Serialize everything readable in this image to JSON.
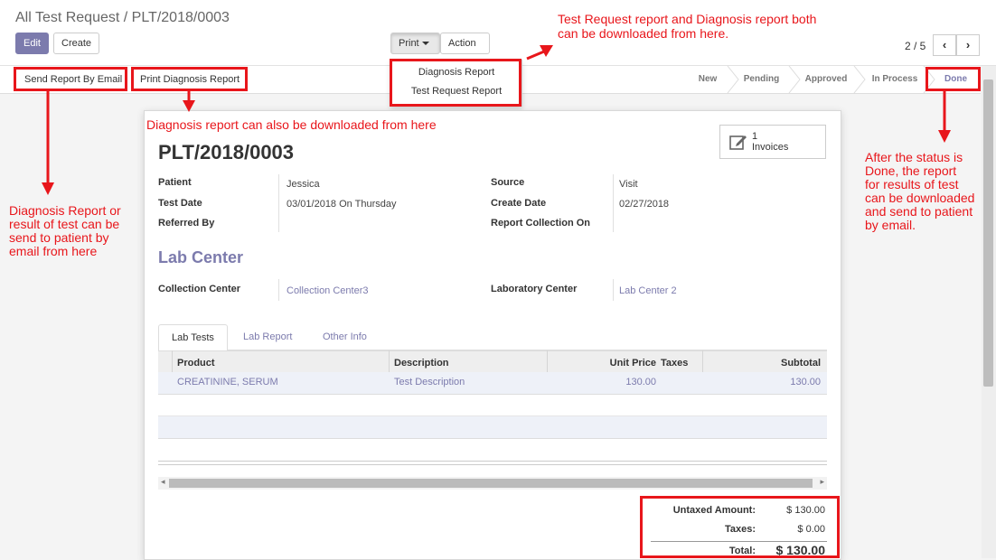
{
  "breadcrumb": {
    "parent": "All Test Request",
    "sep": " / ",
    "current": "PLT/2018/0003"
  },
  "toolbar": {
    "edit": "Edit",
    "create": "Create",
    "print": "Print",
    "action": "Action"
  },
  "pager": {
    "value": "2 / 5",
    "prev": "‹",
    "next": "›"
  },
  "print_menu": {
    "items": [
      "Diagnosis Report",
      "Test Request Report"
    ]
  },
  "statusbar": {
    "send_email": "Send Report By Email",
    "print_diagnosis": "Print Diagnosis Report",
    "stages": [
      "New",
      "Pending",
      "Approved",
      "In Process",
      "Done"
    ],
    "current_stage": "Done"
  },
  "record": {
    "name": "PLT/2018/0003",
    "invoices_count": "1",
    "invoices_label": "Invoices",
    "fields_left": [
      {
        "label": "Patient",
        "value": "Jessica"
      },
      {
        "label": "Test Date",
        "value": "03/01/2018 On Thursday"
      },
      {
        "label": "Referred By",
        "value": ""
      }
    ],
    "fields_right": [
      {
        "label": "Source",
        "value": "Visit"
      },
      {
        "label": "Create Date",
        "value": "02/27/2018"
      },
      {
        "label": "Report Collection On",
        "value": ""
      }
    ],
    "section_title": "Lab Center",
    "collection_center_label": "Collection Center",
    "collection_center_value": "Collection Center3",
    "laboratory_center_label": "Laboratory Center",
    "laboratory_center_value": "Lab Center 2"
  },
  "tabs": [
    "Lab Tests",
    "Lab Report",
    "Other Info"
  ],
  "table": {
    "headers": [
      "Product",
      "Description",
      "Unit Price",
      "Taxes",
      "Subtotal"
    ],
    "rows": [
      {
        "product": "CREATININE, SERUM",
        "description": "Test Description",
        "unit_price": "130.00",
        "taxes": "",
        "subtotal": "130.00"
      }
    ]
  },
  "totals": {
    "untaxed_label": "Untaxed Amount:",
    "untaxed_value": "$ 130.00",
    "taxes_label": "Taxes:",
    "taxes_value": "$ 0.00",
    "total_label": "Total:",
    "total_value": "$ 130.00"
  },
  "annotations": {
    "print_note_1": "Test Request report and Diagnosis report both",
    "print_note_2": "can be downloaded from here.",
    "sheet_note": "Diagnosis report can also be downloaded from here",
    "email_note": [
      "Diagnosis Report or",
      "result of test can be",
      "send to patient by",
      "email from here"
    ],
    "done_note": [
      "After the status is",
      "Done, the report",
      "for results of test",
      "can be downloaded",
      "and send to patient",
      "by email."
    ]
  },
  "colors": {
    "brand": "#7c7bad",
    "annotation": "#e8161b"
  }
}
